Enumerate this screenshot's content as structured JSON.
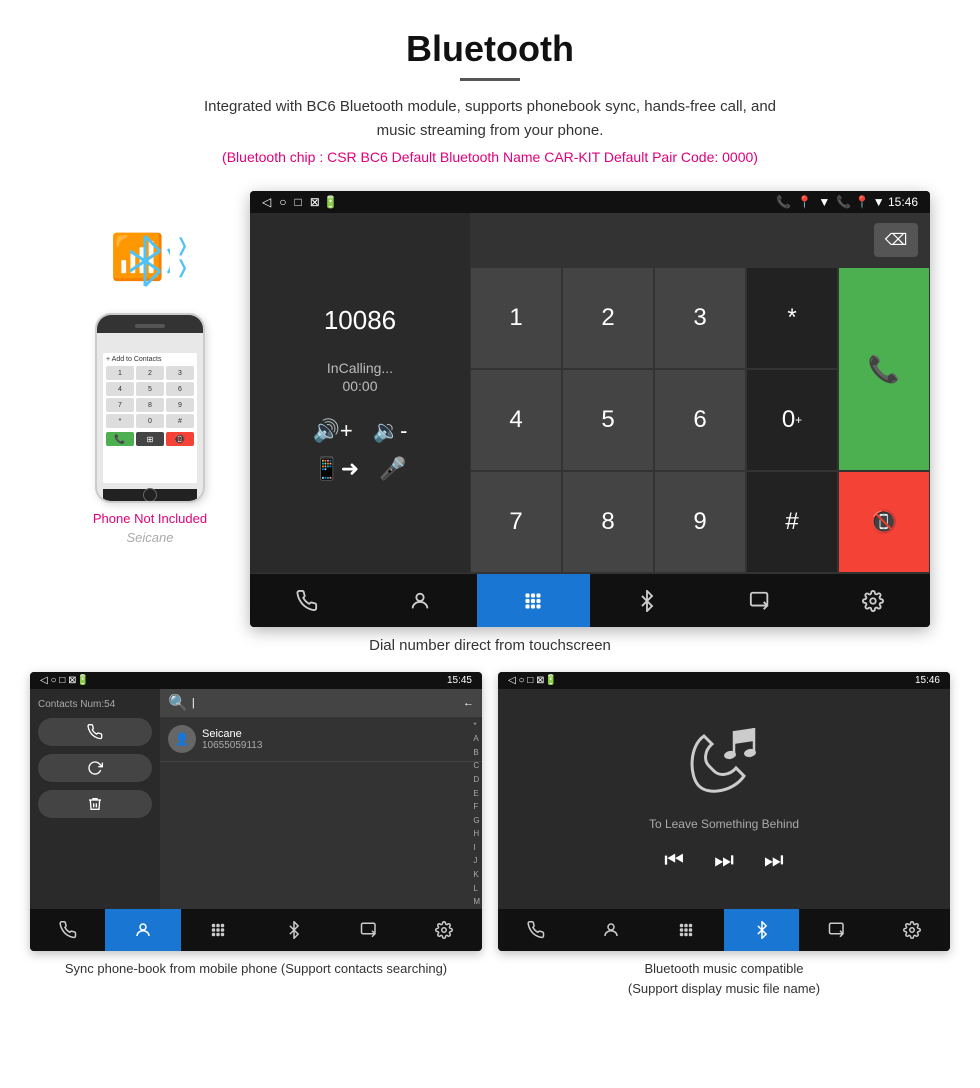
{
  "header": {
    "title": "Bluetooth",
    "subtitle": "Integrated with BC6 Bluetooth module, supports phonebook sync, hands-free call, and music streaming from your phone.",
    "specs": "(Bluetooth chip : CSR BC6    Default Bluetooth Name CAR-KIT    Default Pair Code: 0000)"
  },
  "phone_not_included": "Phone Not Included",
  "seicane_logo": "Seicane",
  "main_screen": {
    "status_bar": {
      "left": "◁  ○  □",
      "right_icons": "📞  📍  ▼  15:46"
    },
    "dial_number": "10086",
    "calling_text": "InCalling...",
    "calling_time": "00:00",
    "dialpad_keys": [
      [
        "1",
        "2",
        "3",
        "*"
      ],
      [
        "4",
        "5",
        "6",
        "0+"
      ],
      [
        "7",
        "8",
        "9",
        "#"
      ]
    ],
    "bottom_nav": [
      "📞↔",
      "👤",
      "⊞",
      "✱⤙",
      "📱→",
      "⚙"
    ]
  },
  "main_caption": "Dial number direct from touchscreen",
  "contacts_screen": {
    "contacts_num": "Contacts Num:54",
    "search_placeholder": "Seicane",
    "contact_number": "10655059113",
    "alpha_list": [
      "A",
      "B",
      "C",
      "D",
      "E",
      "F",
      "G",
      "H",
      "I",
      "J",
      "K",
      "L",
      "M"
    ],
    "bottom_nav": [
      "📞↔",
      "👤",
      "⊞",
      "✱⤙",
      "📱→",
      "⚙"
    ],
    "time": "15:45"
  },
  "music_screen": {
    "title": "To Leave Something Behind",
    "time": "15:46"
  },
  "bottom_captions": {
    "contacts": "Sync phone-book from mobile phone\n(Support contacts searching)",
    "music": "Bluetooth music compatible\n(Support display music file name)"
  }
}
